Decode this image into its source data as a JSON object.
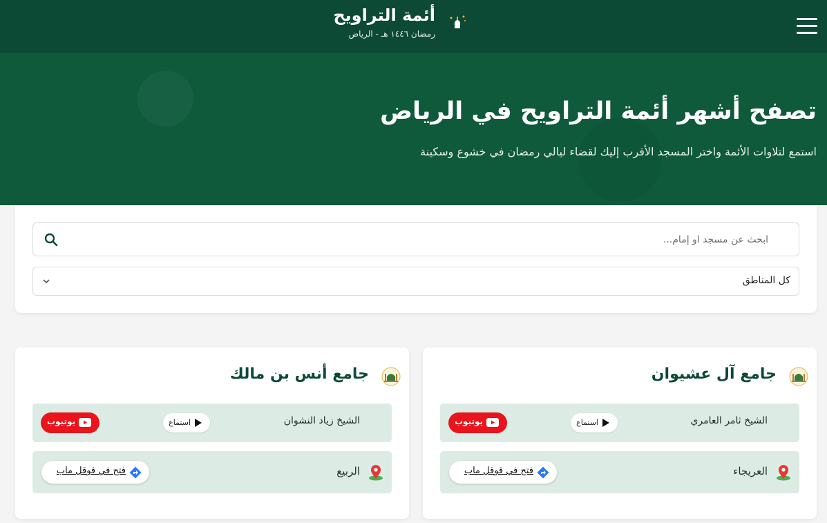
{
  "header": {
    "title": "أئمة التراويح",
    "subtitle": "رمضان ١٤٤٦ هـ - الرياض"
  },
  "hero": {
    "title": "تصفح أشهر أئمة التراويح في الرياض",
    "subtitle": "استمع لتلاوات الأئمة واختر المسجد الأقرب إليك لقضاء ليالي رمضان في خشوع وسكينة"
  },
  "filters": {
    "search_placeholder": "ابحث عن مسجد او إمام...",
    "region_selected": "كل المناطق"
  },
  "mosques": [
    {
      "name": "جامع آل عشيوان",
      "imam": "الشيخ ثامر العامري",
      "listen_label": "استماع",
      "youtube_label": "يوتيوب",
      "district": "العريجاء",
      "maps_label": "فتح في قوقل ماب"
    },
    {
      "name": "جامع أنس بن مالك",
      "imam": "الشيخ زياد النشوان",
      "listen_label": "استماع",
      "youtube_label": "يوتيوب",
      "district": "الربيع",
      "maps_label": "فتح في قوقل ماب"
    }
  ],
  "colors": {
    "primary": "#0d4a35",
    "hero": "#0e5a3b",
    "row_bg": "#dcece5",
    "youtube": "#e9141c"
  },
  "icons": [
    "menu-icon",
    "crescent-mosque-logo-icon",
    "search-icon",
    "chevron-down-icon",
    "mosque-icon",
    "play-icon",
    "youtube-icon",
    "map-pin-icon",
    "google-maps-icon"
  ]
}
